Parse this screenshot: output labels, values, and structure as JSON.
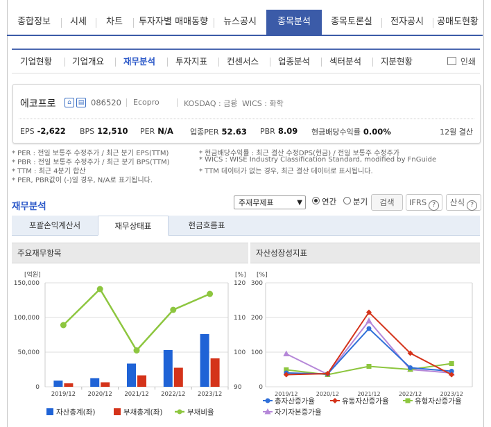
{
  "top_nav": [
    "종합정보",
    "시세",
    "차트",
    "투자자별 매매동향",
    "뉴스공시",
    "종목분석",
    "종목토론실",
    "전자공시",
    "공매도현황"
  ],
  "top_nav_active": "종목분석",
  "sub_nav": [
    "기업현황",
    "기업개요",
    "재무분석",
    "투자지표",
    "컨센서스",
    "업종분석",
    "섹터분석",
    "지분현황"
  ],
  "sub_nav_active": "재무분석",
  "print_label": "인쇄",
  "company": {
    "name": "에코프로",
    "code": "086520",
    "name_en": "Ecopro",
    "market": "KOSDAQ : 금융",
    "wics": "WICS : 화학",
    "stats": [
      {
        "label": "EPS",
        "value": "-2,622"
      },
      {
        "label": "BPS",
        "value": "12,510"
      },
      {
        "label": "PER",
        "value": "N/A"
      },
      {
        "label": "업종PER",
        "value": "52.63"
      },
      {
        "label": "PBR",
        "value": "8.09"
      },
      {
        "label": "현금배당수익률",
        "value": "0.00%"
      }
    ],
    "fiscal": "12월 결산"
  },
  "notes": {
    "left": [
      "* PER : 전일 보통주 수정주가 / 최근 분기 EPS(TTM)",
      "* PBR : 전일 보통주 수정주가 / 최근 분기 BPS(TTM)",
      "* TTM : 최근 4분기 합산",
      "* PER, PBR값이 (-)일 경우, N/A로 표기됩니다."
    ],
    "right": [
      "* 현금배당수익률 : 최근 결산 수정DPS(현금) / 전일 보통주 수정주가",
      "* WICS : WISE Industry Classification Standard, modified by FnGuide",
      "* TTM 데이터가 없는 경우, 최근 결산 데이터로 표시됩니다."
    ]
  },
  "section_title": "재무분석",
  "controls": {
    "select_value": "주재무제표",
    "radio_annual": "연간",
    "radio_quarter": "분기",
    "search": "검색",
    "ifrs": "IFRS",
    "formula": "산식",
    "help_icon": "?"
  },
  "report_tabs": [
    "포괄손익계산서",
    "재무상태표",
    "현금흐름표"
  ],
  "report_tab_active": "재무상태표",
  "colors": {
    "accent": "#3b5ba8",
    "link": "#2b58c8",
    "bar_blue": "#1f63d6",
    "bar_red": "#d4331a",
    "line_green": "#8dc63f",
    "line_purple": "#b587d8"
  },
  "chart_left_title": "주요재무항목",
  "chart_right_title": "자산성장성지표",
  "chart_data": [
    {
      "type": "bar",
      "title": "주요재무항목",
      "categories": [
        "2019/12",
        "2020/12",
        "2021/12",
        "2022/12",
        "2023/12"
      ],
      "y_left_unit": "[억원]",
      "y_right_unit": "[%]",
      "y_left_ticks": [
        "0",
        "50,000",
        "100,000",
        "150,000"
      ],
      "y_right_ticks": [
        "90",
        "100",
        "110",
        "120"
      ],
      "ylim_left": [
        0,
        150000
      ],
      "ylim_right": [
        90,
        120
      ],
      "series": [
        {
          "name": "자산총계(좌)",
          "type": "bar",
          "axis": "left",
          "values": [
            9000,
            12500,
            33500,
            53000,
            76000
          ]
        },
        {
          "name": "부채총계(좌)",
          "type": "bar",
          "axis": "left",
          "values": [
            5000,
            6500,
            16500,
            27500,
            41000
          ]
        },
        {
          "name": "부채비율",
          "type": "line",
          "axis": "right",
          "values": [
            107.8,
            118.2,
            100.5,
            112.2,
            116.8
          ]
        }
      ]
    },
    {
      "type": "line",
      "title": "자산성장성지표",
      "categories": [
        "2019/12",
        "2020/12",
        "2021/12",
        "2022/12",
        "2023/12"
      ],
      "y_unit": "[%]",
      "y_ticks": [
        "0",
        "100",
        "200",
        "300"
      ],
      "ylim": [
        0,
        300
      ],
      "series": [
        {
          "name": "총자산증가율",
          "values": [
            40,
            37,
            168,
            55,
            45
          ]
        },
        {
          "name": "유동자산증가율",
          "values": [
            35,
            38,
            215,
            97,
            35
          ]
        },
        {
          "name": "유형자산증가율",
          "values": [
            49,
            35,
            59,
            50,
            67
          ]
        },
        {
          "name": "자기자본증가율",
          "values": [
            95,
            36,
            190,
            50,
            40
          ]
        }
      ]
    }
  ]
}
